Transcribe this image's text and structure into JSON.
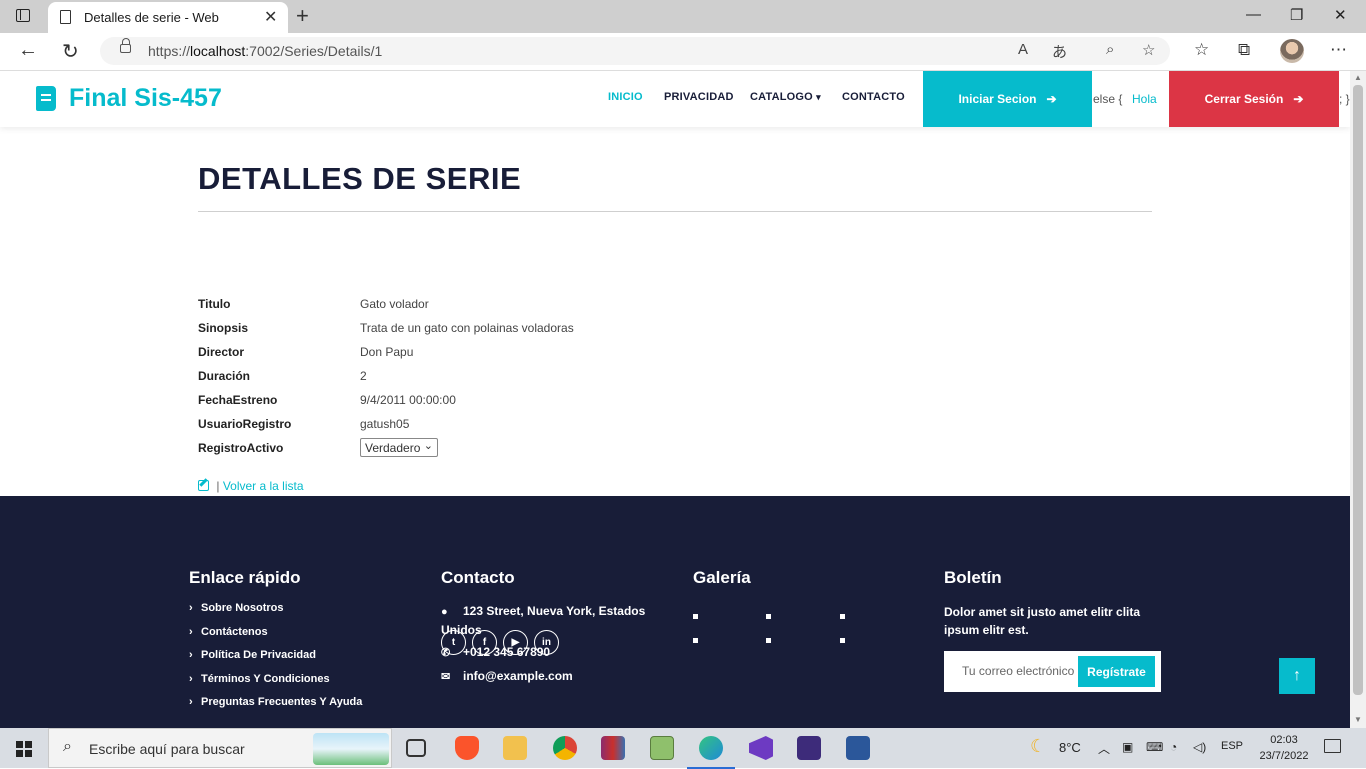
{
  "browser": {
    "tab_title": "Detalles de serie - Web",
    "url_scheme": "https://",
    "url_host": "localhost",
    "url_rest": ":7002/Series/Details/1"
  },
  "navbar": {
    "brand": "Final Sis-457",
    "items": [
      "INICIO",
      "PRIVACIDAD",
      "CATALOGO",
      "CONTACTO"
    ],
    "login_label": "Iniciar Secion",
    "code_left": "else {",
    "hola": "Hola",
    "logout_label": "Cerrar Sesión",
    "code_right": "; }"
  },
  "details": {
    "title": "DETALLES DE SERIE",
    "fields": [
      {
        "label": "Titulo",
        "value": "Gato volador"
      },
      {
        "label": "Sinopsis",
        "value": "Trata de un gato con polainas voladoras"
      },
      {
        "label": "Director",
        "value": "Don Papu"
      },
      {
        "label": "Duración",
        "value": "2"
      },
      {
        "label": "FechaEstreno",
        "value": "9/4/2011 00:00:00"
      },
      {
        "label": "UsuarioRegistro",
        "value": "gatush05"
      },
      {
        "label": "RegistroActivo",
        "value": "Verdadero"
      }
    ],
    "separator": "|",
    "back_link": "Volver a la lista"
  },
  "footer": {
    "quick_title": "Enlace rápido",
    "quick_links": [
      "Sobre Nosotros",
      "Contáctenos",
      "Política De Privacidad",
      "Términos Y Condiciones",
      "Preguntas Frecuentes Y Ayuda"
    ],
    "contact_title": "Contacto",
    "address_line1": "123 Street, Nueva York, Estados",
    "address_line2": "Unidos",
    "phone": "+012 345 67890",
    "email": "info@example.com",
    "gallery_title": "Galería",
    "news_title": "Boletín",
    "news_text": "Dolor amet sit justo amet elitr clita ipsum elitr est.",
    "news_placeholder": "Tu correo electrónico",
    "news_button": "Regístrate"
  },
  "taskbar": {
    "search_placeholder": "Escribe aquí para buscar",
    "temperature": "8°C",
    "language": "ESP",
    "time": "02:03",
    "date": "23/7/2022"
  },
  "colors": {
    "accent": "#06bbcc",
    "dark": "#181d38",
    "danger": "#dc3545"
  }
}
